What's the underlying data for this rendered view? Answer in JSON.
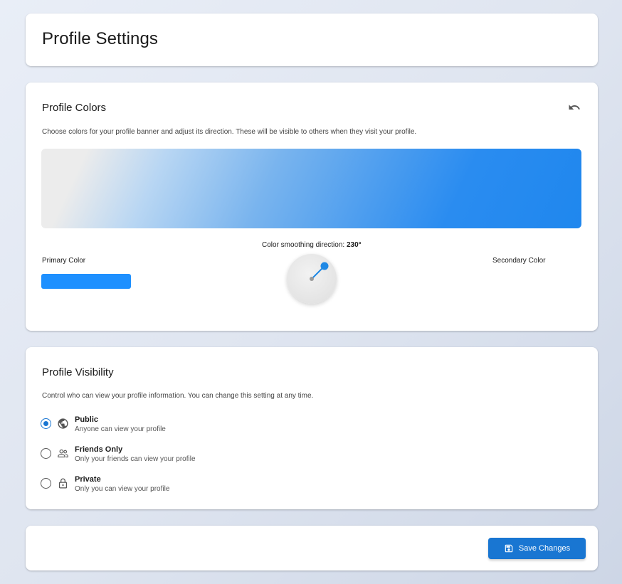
{
  "header": {
    "title": "Profile Settings"
  },
  "colors": {
    "title": "Profile Colors",
    "description": "Choose colors for your profile banner and adjust its direction. These will be visible to others when they visit your profile.",
    "direction_label": "Color smoothing direction:",
    "direction_value": "230°",
    "direction_degrees": 230,
    "primary_label": "Primary Color",
    "secondary_label": "Secondary Color",
    "primary_color": "#1e90ff",
    "secondary_color": "#ececec",
    "reset_icon": "undo-icon"
  },
  "visibility": {
    "title": "Profile Visibility",
    "description": "Control who can view your profile information. You can change this setting at any time.",
    "options": [
      {
        "title": "Public",
        "subtitle": "Anyone can view your profile",
        "icon": "globe-icon",
        "selected": true
      },
      {
        "title": "Friends Only",
        "subtitle": "Only your friends can view your profile",
        "icon": "people-icon",
        "selected": false
      },
      {
        "title": "Private",
        "subtitle": "Only you can view your profile",
        "icon": "lock-icon",
        "selected": false
      }
    ]
  },
  "actions": {
    "save_label": "Save Changes",
    "save_icon": "save-icon"
  },
  "theme": {
    "accent": "#1976d2"
  }
}
